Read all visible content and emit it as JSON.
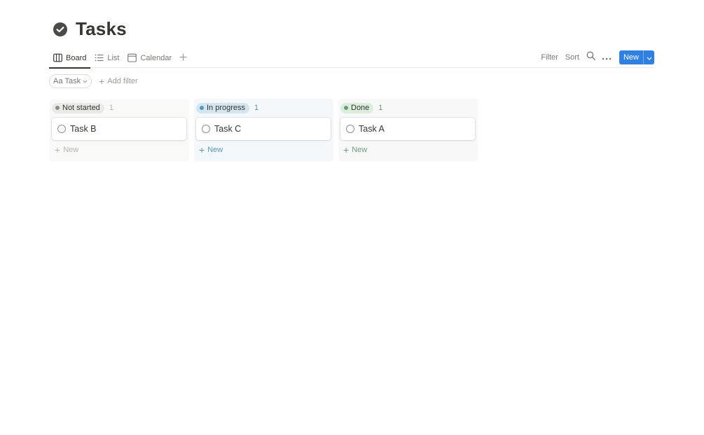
{
  "page": {
    "title": "Tasks",
    "icon": "check-circle-icon"
  },
  "tabs": [
    {
      "label": "Board",
      "icon": "board-icon",
      "active": true
    },
    {
      "label": "List",
      "icon": "list-icon",
      "active": false
    },
    {
      "label": "Calendar",
      "icon": "calendar-icon",
      "active": false
    }
  ],
  "toolbar": {
    "filter_label": "Filter",
    "sort_label": "Sort",
    "new_label": "New"
  },
  "filters": {
    "property_icon_text": "Aa",
    "property_label": "Task",
    "add_filter_label": "Add filter"
  },
  "columns": [
    {
      "status": "Not started",
      "count": "1",
      "pill_bg": "#e9e9e7",
      "dot_color": "#8c8c89",
      "col_bg": "#f9f9f8",
      "muted_color": "#b4b4b0",
      "cards": [
        {
          "title": "Task B"
        }
      ],
      "new_label": "New"
    },
    {
      "status": "In progress",
      "count": "1",
      "pill_bg": "#d3e5ef",
      "dot_color": "#5b97bd",
      "col_bg": "#f4f8fb",
      "muted_color": "#5b97bd",
      "cards": [
        {
          "title": "Task C"
        }
      ],
      "new_label": "New"
    },
    {
      "status": "Done",
      "count": "1",
      "pill_bg": "#dbeddb",
      "dot_color": "#6c9b7d",
      "col_bg": "#f7f8f7",
      "muted_color": "#6c9b7d",
      "cards": [
        {
          "title": "Task A"
        }
      ],
      "new_label": "New"
    }
  ],
  "colors": {
    "accent": "#2f80e0",
    "text": "#37352f",
    "muted": "#787774"
  }
}
